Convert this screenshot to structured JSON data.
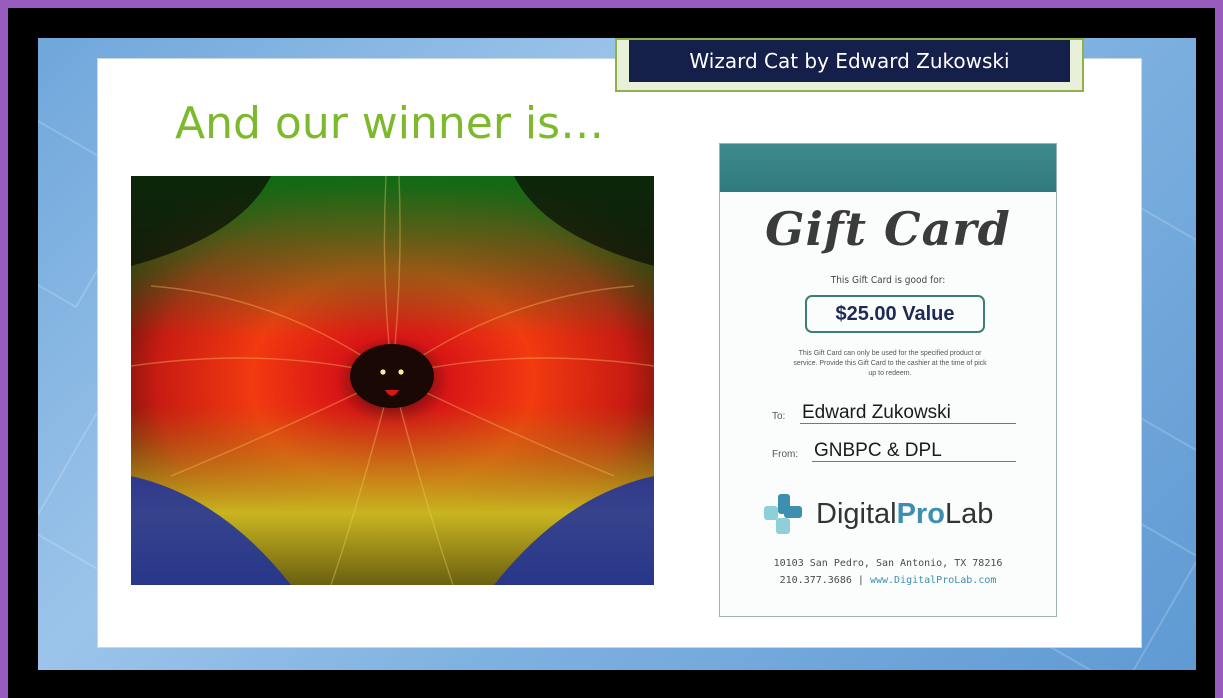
{
  "caption": {
    "text": "Wizard Cat by Edward Zukowski"
  },
  "headline": "And our winner is…",
  "gift_card": {
    "title": "Gift Card",
    "good_for": "This Gift Card is good for:",
    "value": "$25.00 Value",
    "terms": "This Gift Card can only be used for the specified product or service. Provide this Gift Card to the cashier at the time of pick up to redeem.",
    "to_label": "To:",
    "to_value": "Edward Zukowski",
    "from_label": "From:",
    "from_value": "GNBPC & DPL",
    "logo_prefix": "Digital",
    "logo_pro": "Pro",
    "logo_suffix": "Lab",
    "address": "10103 San Pedro, San Antonio, TX 78216",
    "phone": "210.377.3686",
    "separator": "|",
    "website": "www.DigitalProLab.com"
  },
  "colors": {
    "headline": "#7cb92d",
    "caption_bg": "#15204a",
    "card_band": "#3f8a8c",
    "value_border": "#3a7f74",
    "logo_accent": "#3c8fb0"
  }
}
